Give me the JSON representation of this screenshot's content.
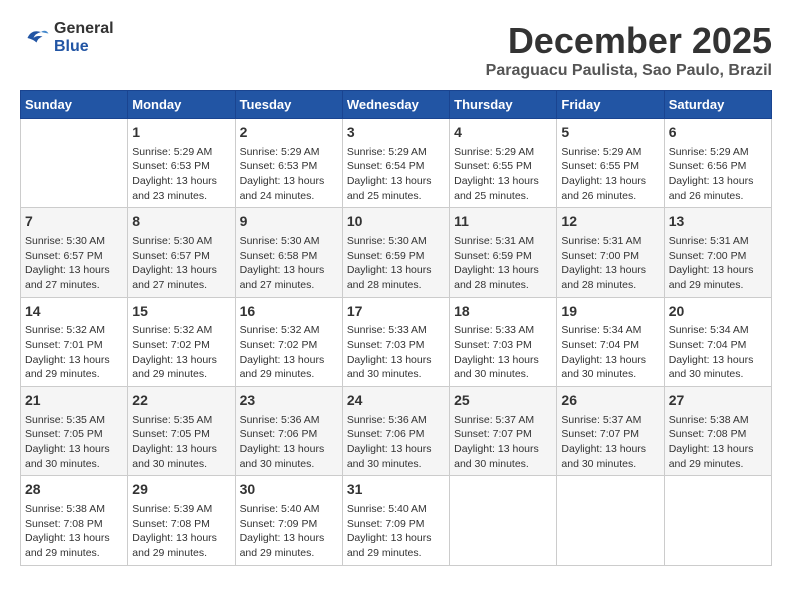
{
  "logo": {
    "line1": "General",
    "line2": "Blue"
  },
  "title": "December 2025",
  "subtitle": "Paraguacu Paulista, Sao Paulo, Brazil",
  "days_of_week": [
    "Sunday",
    "Monday",
    "Tuesday",
    "Wednesday",
    "Thursday",
    "Friday",
    "Saturday"
  ],
  "weeks": [
    [
      {
        "day": "",
        "data": ""
      },
      {
        "day": "1",
        "data": "Sunrise: 5:29 AM\nSunset: 6:53 PM\nDaylight: 13 hours\nand 23 minutes."
      },
      {
        "day": "2",
        "data": "Sunrise: 5:29 AM\nSunset: 6:53 PM\nDaylight: 13 hours\nand 24 minutes."
      },
      {
        "day": "3",
        "data": "Sunrise: 5:29 AM\nSunset: 6:54 PM\nDaylight: 13 hours\nand 25 minutes."
      },
      {
        "day": "4",
        "data": "Sunrise: 5:29 AM\nSunset: 6:55 PM\nDaylight: 13 hours\nand 25 minutes."
      },
      {
        "day": "5",
        "data": "Sunrise: 5:29 AM\nSunset: 6:55 PM\nDaylight: 13 hours\nand 26 minutes."
      },
      {
        "day": "6",
        "data": "Sunrise: 5:29 AM\nSunset: 6:56 PM\nDaylight: 13 hours\nand 26 minutes."
      }
    ],
    [
      {
        "day": "7",
        "data": "Sunrise: 5:30 AM\nSunset: 6:57 PM\nDaylight: 13 hours\nand 27 minutes."
      },
      {
        "day": "8",
        "data": "Sunrise: 5:30 AM\nSunset: 6:57 PM\nDaylight: 13 hours\nand 27 minutes."
      },
      {
        "day": "9",
        "data": "Sunrise: 5:30 AM\nSunset: 6:58 PM\nDaylight: 13 hours\nand 27 minutes."
      },
      {
        "day": "10",
        "data": "Sunrise: 5:30 AM\nSunset: 6:59 PM\nDaylight: 13 hours\nand 28 minutes."
      },
      {
        "day": "11",
        "data": "Sunrise: 5:31 AM\nSunset: 6:59 PM\nDaylight: 13 hours\nand 28 minutes."
      },
      {
        "day": "12",
        "data": "Sunrise: 5:31 AM\nSunset: 7:00 PM\nDaylight: 13 hours\nand 28 minutes."
      },
      {
        "day": "13",
        "data": "Sunrise: 5:31 AM\nSunset: 7:00 PM\nDaylight: 13 hours\nand 29 minutes."
      }
    ],
    [
      {
        "day": "14",
        "data": "Sunrise: 5:32 AM\nSunset: 7:01 PM\nDaylight: 13 hours\nand 29 minutes."
      },
      {
        "day": "15",
        "data": "Sunrise: 5:32 AM\nSunset: 7:02 PM\nDaylight: 13 hours\nand 29 minutes."
      },
      {
        "day": "16",
        "data": "Sunrise: 5:32 AM\nSunset: 7:02 PM\nDaylight: 13 hours\nand 29 minutes."
      },
      {
        "day": "17",
        "data": "Sunrise: 5:33 AM\nSunset: 7:03 PM\nDaylight: 13 hours\nand 30 minutes."
      },
      {
        "day": "18",
        "data": "Sunrise: 5:33 AM\nSunset: 7:03 PM\nDaylight: 13 hours\nand 30 minutes."
      },
      {
        "day": "19",
        "data": "Sunrise: 5:34 AM\nSunset: 7:04 PM\nDaylight: 13 hours\nand 30 minutes."
      },
      {
        "day": "20",
        "data": "Sunrise: 5:34 AM\nSunset: 7:04 PM\nDaylight: 13 hours\nand 30 minutes."
      }
    ],
    [
      {
        "day": "21",
        "data": "Sunrise: 5:35 AM\nSunset: 7:05 PM\nDaylight: 13 hours\nand 30 minutes."
      },
      {
        "day": "22",
        "data": "Sunrise: 5:35 AM\nSunset: 7:05 PM\nDaylight: 13 hours\nand 30 minutes."
      },
      {
        "day": "23",
        "data": "Sunrise: 5:36 AM\nSunset: 7:06 PM\nDaylight: 13 hours\nand 30 minutes."
      },
      {
        "day": "24",
        "data": "Sunrise: 5:36 AM\nSunset: 7:06 PM\nDaylight: 13 hours\nand 30 minutes."
      },
      {
        "day": "25",
        "data": "Sunrise: 5:37 AM\nSunset: 7:07 PM\nDaylight: 13 hours\nand 30 minutes."
      },
      {
        "day": "26",
        "data": "Sunrise: 5:37 AM\nSunset: 7:07 PM\nDaylight: 13 hours\nand 30 minutes."
      },
      {
        "day": "27",
        "data": "Sunrise: 5:38 AM\nSunset: 7:08 PM\nDaylight: 13 hours\nand 29 minutes."
      }
    ],
    [
      {
        "day": "28",
        "data": "Sunrise: 5:38 AM\nSunset: 7:08 PM\nDaylight: 13 hours\nand 29 minutes."
      },
      {
        "day": "29",
        "data": "Sunrise: 5:39 AM\nSunset: 7:08 PM\nDaylight: 13 hours\nand 29 minutes."
      },
      {
        "day": "30",
        "data": "Sunrise: 5:40 AM\nSunset: 7:09 PM\nDaylight: 13 hours\nand 29 minutes."
      },
      {
        "day": "31",
        "data": "Sunrise: 5:40 AM\nSunset: 7:09 PM\nDaylight: 13 hours\nand 29 minutes."
      },
      {
        "day": "",
        "data": ""
      },
      {
        "day": "",
        "data": ""
      },
      {
        "day": "",
        "data": ""
      }
    ]
  ]
}
